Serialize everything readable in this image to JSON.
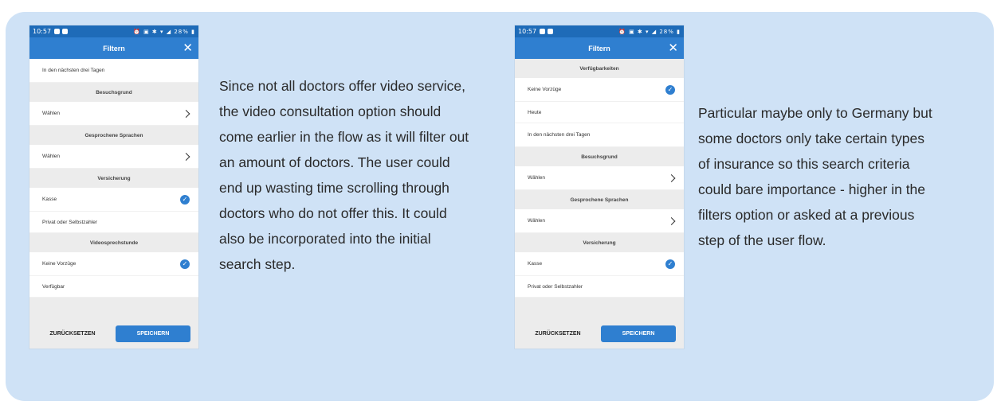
{
  "phone_left": {
    "status_time": "10:57",
    "status_icons": "⏰ ▣ ✱ ▾ ◢ 28% ▮",
    "title": "Filtern",
    "close_glyph": "✕",
    "rows": [
      {
        "kind": "row",
        "label": "In den nächsten drei Tagen",
        "h": "tall"
      },
      {
        "kind": "section",
        "label": "Besuchsgrund"
      },
      {
        "kind": "row",
        "label": "Wählen",
        "chevron": true,
        "h": "tall"
      },
      {
        "kind": "section",
        "label": "Gesprochene Sprachen"
      },
      {
        "kind": "row",
        "label": "Wählen",
        "chevron": true,
        "h": "tall"
      },
      {
        "kind": "section",
        "label": "Versicherung"
      },
      {
        "kind": "row",
        "label": "Kasse",
        "check": true,
        "h": "tall"
      },
      {
        "kind": "row",
        "label": "Privat oder Selbstzahler",
        "h": "short"
      },
      {
        "kind": "section",
        "label": "Videosprechstunde"
      },
      {
        "kind": "row",
        "label": "Keine Vorzüge",
        "check": true,
        "h": "tall"
      },
      {
        "kind": "row",
        "label": "Verfügbar",
        "h": "short"
      }
    ],
    "reset_label": "ZURÜCKSETZEN",
    "save_label": "SPEICHERN"
  },
  "phone_right": {
    "status_time": "10:57",
    "status_icons": "⏰ ▣ ✱ ▾ ◢ 28% ▮",
    "title": "Filtern",
    "close_glyph": "✕",
    "rows": [
      {
        "kind": "section",
        "label": "Verfügbarkeiten"
      },
      {
        "kind": "row",
        "label": "Keine Vorzüge",
        "check": true,
        "h": "tall"
      },
      {
        "kind": "row",
        "label": "Heute",
        "h": "short"
      },
      {
        "kind": "row",
        "label": "In den nächsten drei Tagen",
        "h": "tall"
      },
      {
        "kind": "section",
        "label": "Besuchsgrund"
      },
      {
        "kind": "row",
        "label": "Wählen",
        "chevron": true,
        "h": "tall"
      },
      {
        "kind": "section",
        "label": "Gesprochene Sprachen"
      },
      {
        "kind": "row",
        "label": "Wählen",
        "chevron": true,
        "h": "tall"
      },
      {
        "kind": "section",
        "label": "Versicherung"
      },
      {
        "kind": "row",
        "label": "Kasse",
        "check": true,
        "h": "tall"
      },
      {
        "kind": "row",
        "label": "Privat oder Selbstzahler",
        "h": "short"
      }
    ],
    "reset_label": "ZURÜCKSETZEN",
    "save_label": "SPEICHERN"
  },
  "notes": {
    "video_note": "Since not all doctors offer video service, the video consultation option should come earlier in the flow as it will filter out an amount of doctors. The user could end up wasting time scrolling through doctors who do not offer this. It could also be incorporated into the initial search step.",
    "insurance_note": "Particular maybe only to Germany but some doctors only take certain types of insurance so this search criteria could bare importance - higher in the filters option or asked at a previous step of the user flow."
  },
  "colors": {
    "card_bg": "#cfe2f6",
    "appbar": "#2f7fd0",
    "statusbar": "#1e6bb8",
    "accent": "#2f7fd0"
  }
}
